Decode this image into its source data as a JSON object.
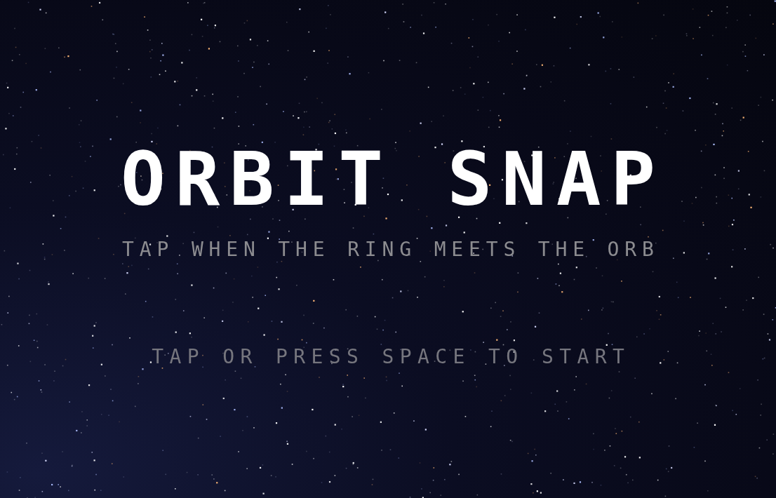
{
  "title": "ORBIT SNAP",
  "subtitle": "TAP WHEN THE RING MEETS THE ORB",
  "prompt": "TAP OR PRESS SPACE TO START"
}
